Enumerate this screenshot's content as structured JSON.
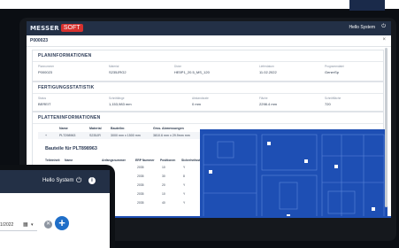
{
  "app": {
    "logo_brand": "MESSER",
    "logo_soft": "SOFT",
    "user_greeting": "Hello System"
  },
  "page": {
    "title": "P000023"
  },
  "planinformationen": {
    "heading": "PLANINFORMATIONEN",
    "fields": [
      {
        "label": "Plannummer",
        "value": "P000023"
      },
      {
        "label": "Material",
        "value": "S235JRG2"
      },
      {
        "label": "Dicke",
        "value": "HE5P1_20.5_MS_120"
      },
      {
        "label": "Lieferdatum",
        "value": "11.02.2022"
      },
      {
        "label": "Programmdatei",
        "value": "GenerSp"
      }
    ]
  },
  "fertigung": {
    "heading": "FERTIGUNGSSTATISTIK",
    "fields": [
      {
        "label": "Status",
        "value": "BEREIT"
      },
      {
        "label": "Schnittlänge",
        "value": "1,153,983 mm"
      },
      {
        "label": "Abstandsrate",
        "value": "0 mm"
      },
      {
        "label": "Fläche",
        "value": "2298.4 mm"
      },
      {
        "label": "Schnittfläche",
        "value": "720"
      }
    ]
  },
  "platten": {
    "heading": "PLATTENINFORMATIONEN",
    "columns": [
      "Name",
      "Material",
      "Bauteilnr.",
      "Grss. Abmessungen"
    ],
    "rows": [
      {
        "marker": "+",
        "name": "PLT298963",
        "material": "S235JR",
        "bauteil": "3000 mm x 1500 mm",
        "abm": "3810.6 mm x 29.9mm mm"
      }
    ]
  },
  "bauteile": {
    "heading": "Bauteile für PLT898963",
    "columns": [
      "Teileinheit",
      "Name",
      "Anfangsnummer",
      "ERP Nummer",
      "Positionen",
      "Sicherheitsstufe"
    ],
    "rows": [
      {
        "date": "2035",
        "qty": "10",
        "flag": "Y"
      },
      {
        "date": "2035",
        "qty": "30",
        "flag": "8"
      },
      {
        "date": "2035",
        "qty": "20",
        "flag": "Y"
      },
      {
        "date": "2035",
        "qty": "10",
        "flag": "Y"
      },
      {
        "date": "2035",
        "qty": "40",
        "flag": "Y"
      }
    ]
  },
  "tablet": {
    "user_greeting": "Hello System",
    "date_value": "1/2022",
    "dropdown_arrow": "▾",
    "add_label": "+",
    "clear_label": "✕"
  },
  "colors": {
    "header": "#233046",
    "brand_red": "#d7312e",
    "drawing_blue": "#1e4fb4",
    "accent_blue": "#1f6ec8"
  },
  "icons": [
    "power-icon",
    "close-icon",
    "calendar-icon",
    "dropdown-icon",
    "clear-icon",
    "plus-icon",
    "info-icon"
  ]
}
